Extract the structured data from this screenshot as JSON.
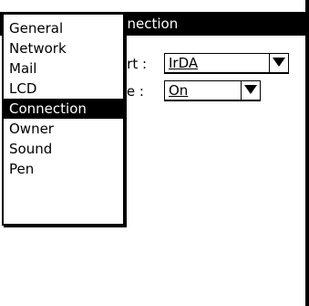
{
  "window": {
    "title_partial": "nnection"
  },
  "form": {
    "port": {
      "label": "ort :",
      "value": "IrDA"
    },
    "active": {
      "label": "ve :",
      "value": "On"
    }
  },
  "menu": {
    "items": [
      {
        "label": "General",
        "selected": false
      },
      {
        "label": "Network",
        "selected": false
      },
      {
        "label": "Mail",
        "selected": false
      },
      {
        "label": "LCD",
        "selected": false
      },
      {
        "label": "Connection",
        "selected": true
      },
      {
        "label": "Owner",
        "selected": false
      },
      {
        "label": "Sound",
        "selected": false
      },
      {
        "label": "Pen",
        "selected": false
      }
    ]
  },
  "colors": {
    "foreground": "#000000",
    "background": "#ffffff"
  },
  "icons": {
    "dropdown": "triangle-down-icon"
  }
}
